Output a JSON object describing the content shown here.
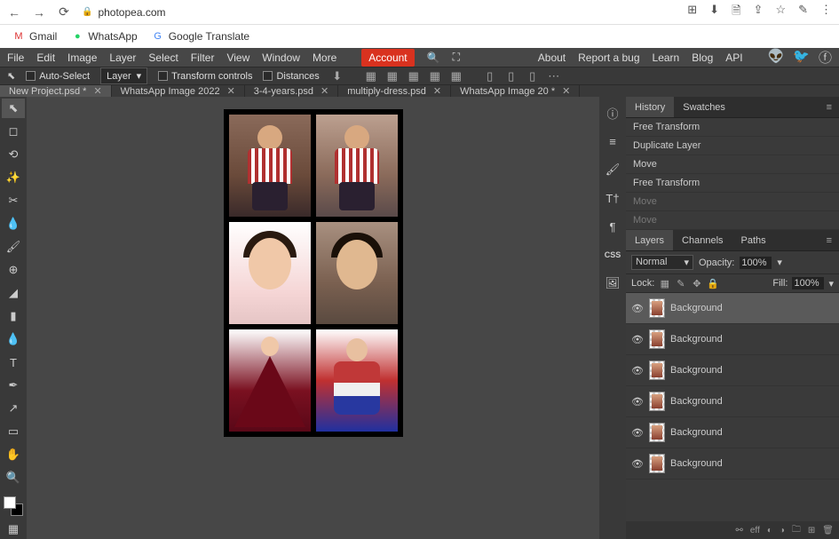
{
  "browser": {
    "url": "photopea.com",
    "bookmarks": [
      {
        "icon": "M",
        "label": "Gmail",
        "cls": "bm-red"
      },
      {
        "icon": "●",
        "label": "WhatsApp",
        "cls": "bm-green"
      },
      {
        "icon": "G",
        "label": "Google Translate",
        "cls": "bm-blue"
      }
    ]
  },
  "menu": {
    "items": [
      "File",
      "Edit",
      "Image",
      "Layer",
      "Select",
      "Filter",
      "View",
      "Window",
      "More"
    ],
    "account": "Account",
    "right": [
      "About",
      "Report a bug",
      "Learn",
      "Blog",
      "API"
    ]
  },
  "options": {
    "auto_select": "Auto-Select",
    "target": "Layer",
    "transform": "Transform controls",
    "distances": "Distances"
  },
  "tabs": [
    {
      "label": "New Project.psd *",
      "active": true
    },
    {
      "label": "WhatsApp Image 2022",
      "active": false
    },
    {
      "label": "3-4-years.psd",
      "active": false
    },
    {
      "label": "multiply-dress.psd",
      "active": false
    },
    {
      "label": "WhatsApp Image 20 *",
      "active": false
    }
  ],
  "history": {
    "tabs": [
      "History",
      "Swatches"
    ],
    "items": [
      {
        "label": "Free Transform",
        "dim": false
      },
      {
        "label": "Duplicate Layer",
        "dim": false
      },
      {
        "label": "Move",
        "dim": false
      },
      {
        "label": "Free Transform",
        "dim": false
      },
      {
        "label": "Move",
        "dim": true
      },
      {
        "label": "Move",
        "dim": true
      }
    ]
  },
  "layers_panel": {
    "tabs": [
      "Layers",
      "Channels",
      "Paths"
    ],
    "blend": "Normal",
    "opacity_label": "Opacity:",
    "opacity": "100%",
    "lock_label": "Lock:",
    "fill_label": "Fill:",
    "fill": "100%",
    "layers": [
      {
        "name": "Background",
        "sel": true
      },
      {
        "name": "Background",
        "sel": false
      },
      {
        "name": "Background",
        "sel": false
      },
      {
        "name": "Background",
        "sel": false
      },
      {
        "name": "Background",
        "sel": false
      },
      {
        "name": "Background",
        "sel": false
      }
    ],
    "footer_link": "eff"
  }
}
